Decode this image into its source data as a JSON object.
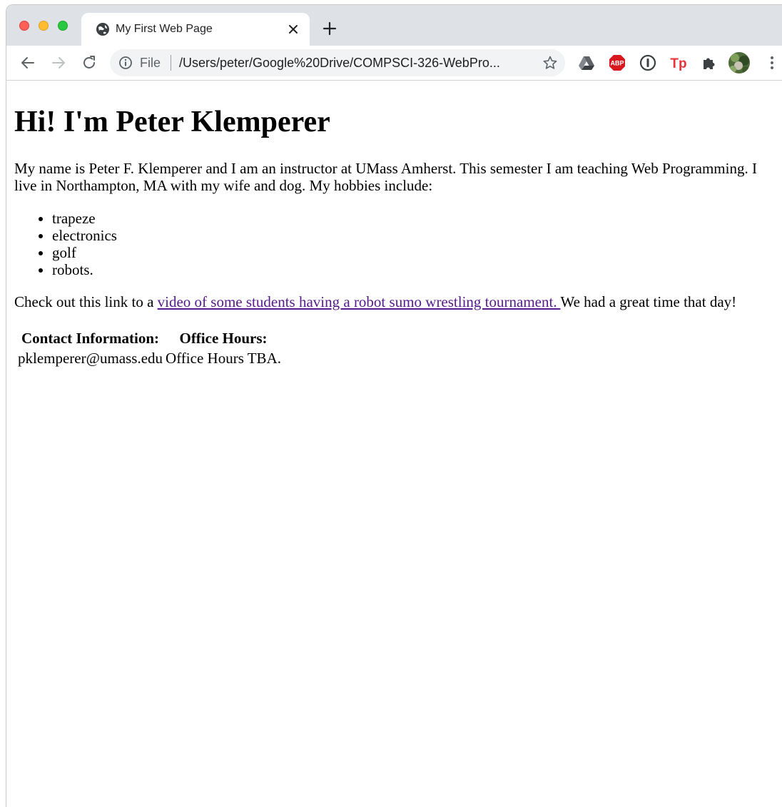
{
  "browser": {
    "tab": {
      "title": "My First Web Page"
    },
    "address_bar": {
      "scheme_label": "File",
      "url": "/Users/peter/Google%20Drive/COMPSCI-326-WebPro..."
    },
    "extensions": [
      "google-drive-icon",
      "adblock-plus-icon",
      "onepassword-icon",
      "tp-icon",
      "puzzle-icon",
      "profile-avatar"
    ]
  },
  "page": {
    "heading": "Hi! I'm Peter Klemperer",
    "intro": "My name is Peter F. Klemperer and I am an instructor at UMass Amherst. This semester I am teaching Web Programming. I live in Northampton, MA with my wife and dog. My hobbies include:",
    "hobbies": [
      "trapeze",
      "electronics",
      "golf",
      "robots."
    ],
    "check_prefix": "Check out this link to a ",
    "link_text": "video of some students having a robot sumo wrestling tournament. ",
    "check_suffix": "We had a great time that day!",
    "table": {
      "headers": [
        "Contact Information:",
        "Office Hours:"
      ],
      "row": [
        "pklemperer@umass.edu",
        "Office Hours TBA."
      ]
    }
  },
  "colors": {
    "tabstrip": "#dee1e6",
    "omnibox": "#f1f3f4",
    "visited_link": "#551a8b",
    "abp_red": "#d7191f",
    "tp_red": "#e8333a"
  }
}
